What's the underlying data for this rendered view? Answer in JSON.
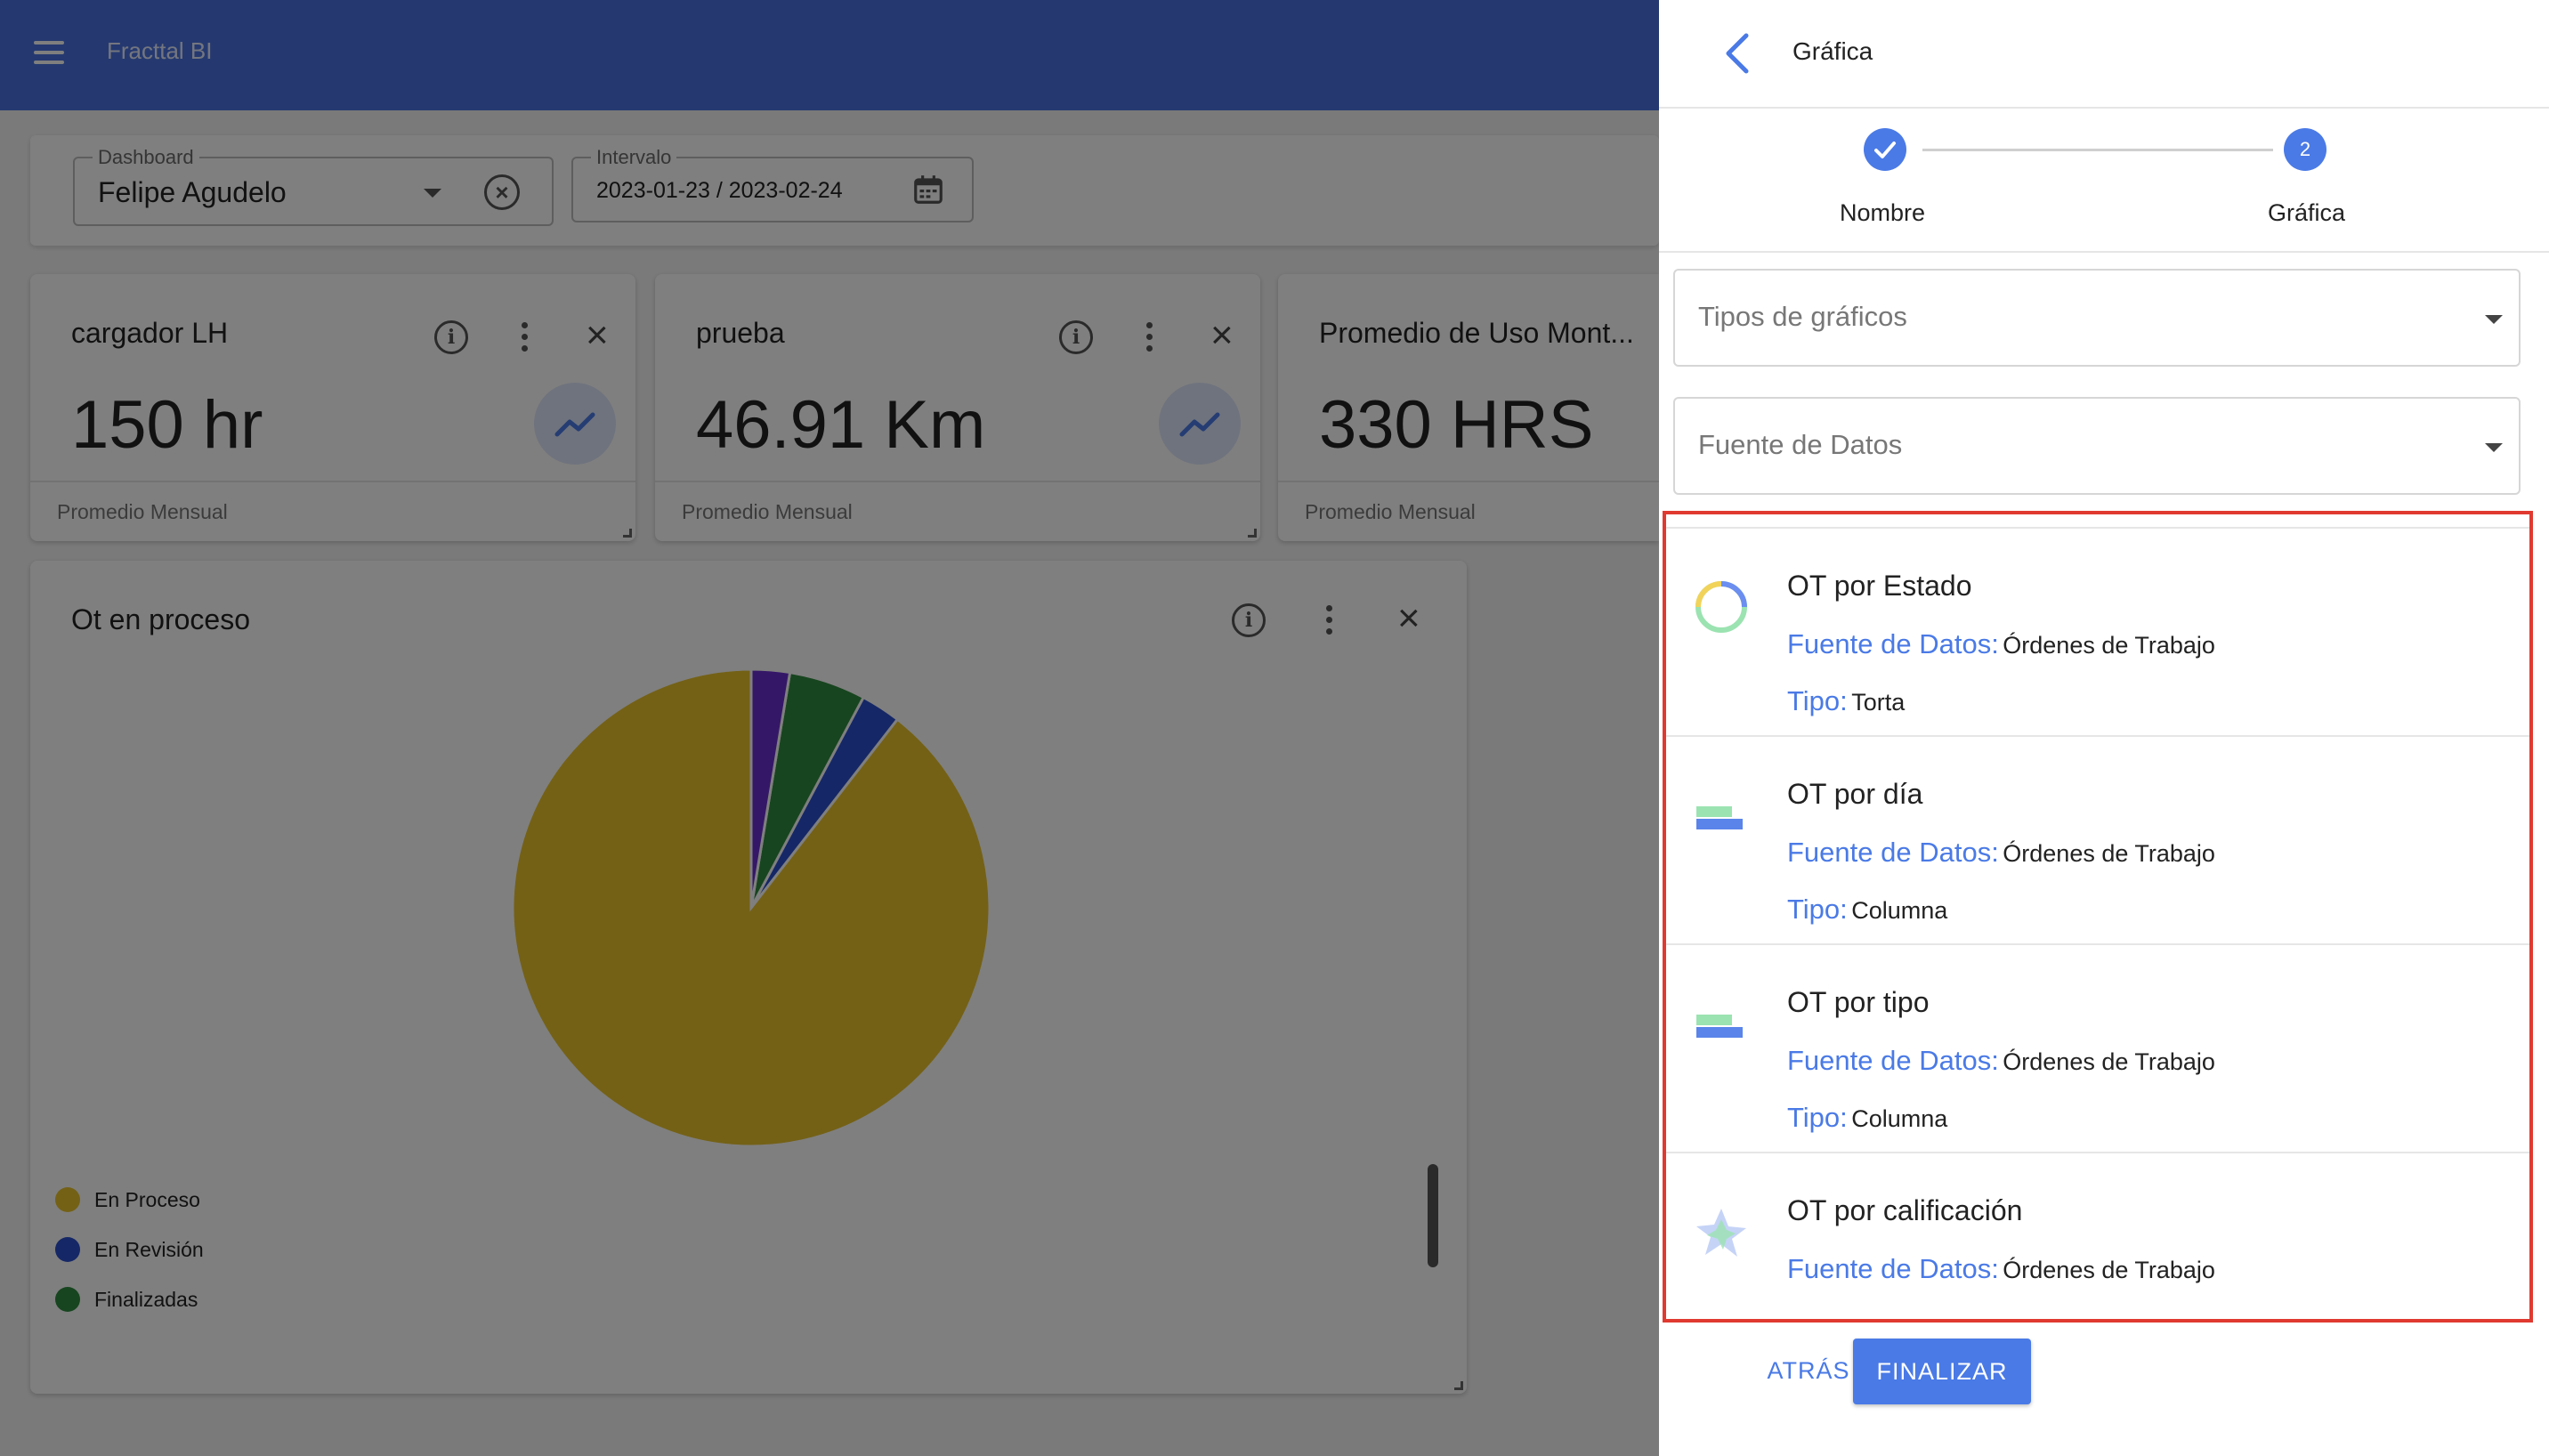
{
  "app": {
    "title": "Fracttal BI"
  },
  "filters": {
    "dashboard": {
      "label": "Dashboard",
      "value": "Felipe Agudelo"
    },
    "interval": {
      "label": "Intervalo",
      "value": "2023-01-23 / 2023-02-24"
    }
  },
  "kpi_cards": [
    {
      "title": "cargador LH",
      "value": "150 hr",
      "footer": "Promedio Mensual"
    },
    {
      "title": "prueba",
      "value": "46.91 Km",
      "footer": "Promedio Mensual"
    },
    {
      "title": "Promedio de Uso Mont...",
      "value": "330 HRS",
      "footer": "Promedio Mensual"
    }
  ],
  "pie_card": {
    "title": "Ot en proceso",
    "legend": [
      {
        "label": "En Proceso",
        "color": "#e8c32c"
      },
      {
        "label": "En Revisión",
        "color": "#2a4fcc"
      },
      {
        "label": "Finalizadas",
        "color": "#2f8a3e"
      }
    ]
  },
  "chart_data": {
    "type": "pie",
    "title": "Ot en proceso",
    "categories": [
      "En Proceso",
      "En Revisión",
      "Finalizadas",
      ""
    ],
    "values": [
      89.5,
      2.7,
      5.2,
      2.6
    ],
    "colors": [
      "#e8c32c",
      "#2a4fcc",
      "#2f8a3e",
      "#6a2ed1"
    ],
    "legend_position": "bottom-left"
  },
  "panel": {
    "title": "Gráfica",
    "steps": [
      {
        "number": "1",
        "label": "Nombre",
        "state": "completed"
      },
      {
        "number": "2",
        "label": "Gráfica",
        "state": "active"
      }
    ],
    "chart_type_placeholder": "Tipos de gráficos",
    "data_source_placeholder": "Fuente de Datos",
    "source_label": "Fuente de Datos:",
    "type_label": "Tipo:",
    "chart_options": [
      {
        "name": "OT por Estado",
        "source": "Órdenes de Trabajo",
        "type": "Torta",
        "icon": "donut-chart-icon"
      },
      {
        "name": "OT por día",
        "source": "Órdenes de Trabajo",
        "type": "Columna",
        "icon": "bar-chart-icon"
      },
      {
        "name": "OT por tipo",
        "source": "Órdenes de Trabajo",
        "type": "Columna",
        "icon": "bar-chart-icon"
      },
      {
        "name": "OT por calificación",
        "source": "Órdenes de Trabajo",
        "type": "",
        "icon": "radar-chart-icon"
      }
    ],
    "back_button": "ATRÁS",
    "finish_button": "FINALIZAR"
  },
  "colors": {
    "primary": "#4a7ae6",
    "topbar": "#4a72e0",
    "highlight_border": "#e03a30"
  }
}
